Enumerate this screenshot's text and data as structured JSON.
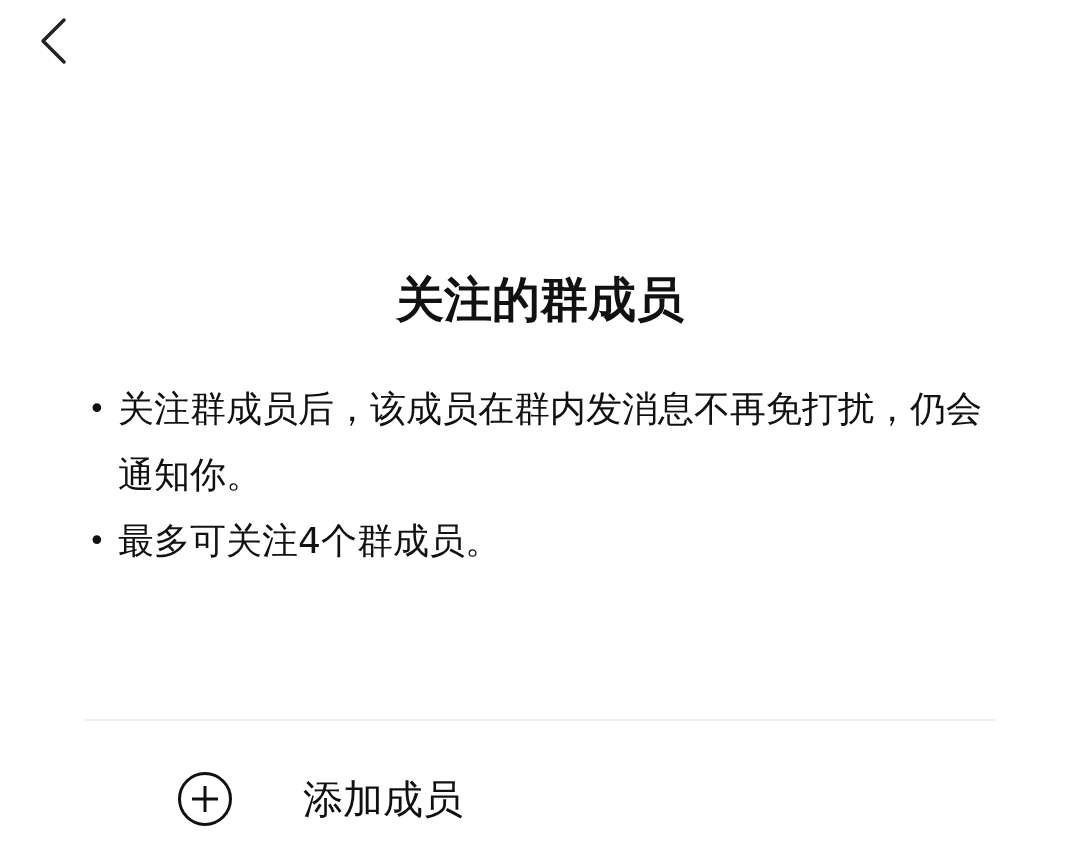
{
  "title": "关注的群成员",
  "notes": [
    {
      "bullet": "•",
      "text": "关注群成员后，该成员在群内发消息不再免打扰，仍会通知你。"
    },
    {
      "bullet": "•",
      "text": "最多可关注4个群成员。"
    }
  ],
  "add_member": {
    "label": "添加成员"
  }
}
